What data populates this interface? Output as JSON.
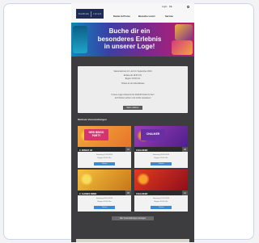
{
  "header": {
    "logo_left": "Stadthalle",
    "logo_right": "Lörrach",
    "login": "Login",
    "language": "DE",
    "nav": [
      "Karten & Preise",
      "Besuche vorort",
      "Service"
    ]
  },
  "hero": {
    "line1": "Buche dir ein",
    "line2": "besonderes Erlebnis",
    "line3": "in unserer Loge!"
  },
  "info": {
    "lines": [
      "Saisonstart am 13. und 14. September 2024",
      "",
      "Einlass ab 18:00 Uhr",
      "Beginn 19:30 Uhr",
      "",
      "Tickets an der Abendkasse",
      "",
      "Unsere Logen & Events für 2024/25 findet ihr hier!",
      "Jetzt Karten sichern und nichts verpassen!"
    ],
    "button": "Mehr erfahren"
  },
  "section_title": "Nächste Veranstaltungen",
  "events": [
    {
      "title": "2. BINGO 92",
      "badge": "NEW BINGO PARTY",
      "number": "21",
      "lines": [
        "Samstag 21.09.2024",
        "Beginn 19:00 Uhr"
      ],
      "button": "Tickets",
      "color_top": "#f2a93b",
      "color_bottom": "#e8742a",
      "badge_color": "#d5346f",
      "sun_color": "#f6d13a"
    },
    {
      "title": "CHALIKER",
      "badge": "CHALIKER",
      "number": "28",
      "lines": [
        "Samstag 28.09.2024",
        "Beginn 20:00 Uhr"
      ],
      "button": "Tickets",
      "color_top": "#9a3fb7",
      "color_bottom": "#4f1e8c",
      "badge_color": "#6a2ea3",
      "sun_color": "#f39a2a"
    },
    {
      "title": "2. GAMES MIND",
      "badge": "",
      "number": "05",
      "lines": [
        "Samstag 05.10.2024",
        "Beginn 19:00 Uhr"
      ],
      "button": "Tickets",
      "color_top": "#f5c23b",
      "color_bottom": "#c6761a",
      "badge_color": "#a31f2a",
      "sun_color": "#f7dd5c"
    },
    {
      "title": "CHALIKER",
      "badge": "",
      "number": "12",
      "lines": [
        "Samstag 12.10.2024",
        "Beginn 20:00 Uhr"
      ],
      "button": "Tickets",
      "color_top": "#e43a1f",
      "color_bottom": "#8f0f1a",
      "badge_color": "#b81627",
      "sun_color": "#f7a12c"
    }
  ],
  "more_button": "Alle Veranstaltungen anzeigen"
}
